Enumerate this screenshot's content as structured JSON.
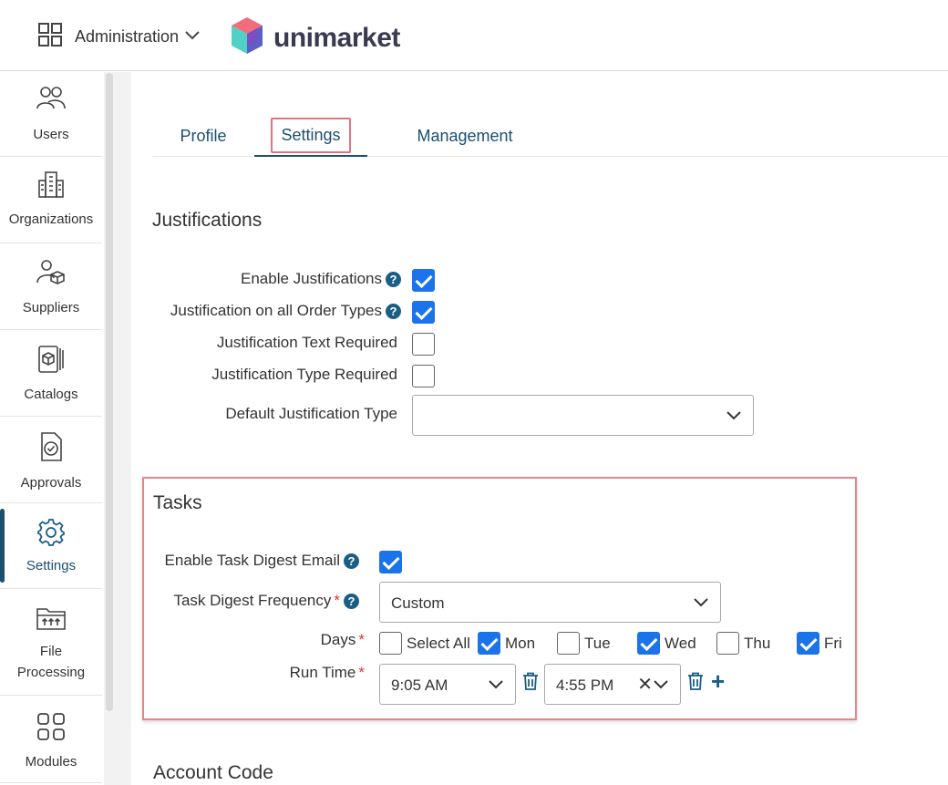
{
  "header": {
    "app_switcher_label": "Administration",
    "brand": "unimarket"
  },
  "sidebar": {
    "items": [
      {
        "label": "Users",
        "icon": "users-icon"
      },
      {
        "label": "Organizations",
        "icon": "building-icon"
      },
      {
        "label": "Suppliers",
        "icon": "supplier-icon"
      },
      {
        "label": "Catalogs",
        "icon": "catalog-icon"
      },
      {
        "label": "Approvals",
        "icon": "approval-icon"
      },
      {
        "label": "Settings",
        "icon": "gear-icon",
        "active": true
      },
      {
        "label": "File Processing",
        "line1": "File",
        "line2": "Processing",
        "icon": "file-processing-icon"
      },
      {
        "label": "Modules",
        "icon": "modules-icon"
      }
    ]
  },
  "tabs": {
    "profile": "Profile",
    "settings": "Settings",
    "management": "Management",
    "active": "Settings"
  },
  "justifications": {
    "title": "Justifications",
    "enable": {
      "label": "Enable Justifications",
      "checked": true
    },
    "all_order_types": {
      "label": "Justification on all Order Types",
      "checked": true
    },
    "text_required": {
      "label": "Justification Text Required",
      "checked": false
    },
    "type_required": {
      "label": "Justification Type Required",
      "checked": false
    },
    "default_type": {
      "label": "Default Justification Type",
      "value": ""
    }
  },
  "tasks": {
    "title": "Tasks",
    "enable_digest": {
      "label": "Enable Task Digest Email",
      "checked": true
    },
    "frequency": {
      "label": "Task Digest Frequency",
      "value": "Custom"
    },
    "days": {
      "label": "Days",
      "select_all": {
        "label": "Select All",
        "checked": false
      },
      "mon": {
        "label": "Mon",
        "checked": true
      },
      "tue": {
        "label": "Tue",
        "checked": false
      },
      "wed": {
        "label": "Wed",
        "checked": true
      },
      "thu": {
        "label": "Thu",
        "checked": false
      },
      "fri": {
        "label": "Fri",
        "checked": true
      }
    },
    "run_time": {
      "label": "Run Time",
      "times": [
        "9:05 AM",
        "4:55 PM"
      ],
      "clear_symbol": "✕",
      "add_symbol": "+"
    }
  },
  "account_code": {
    "title": "Account Code"
  },
  "help_glyph": "?",
  "required_marker": "*",
  "colors": {
    "accent": "#1b4f72",
    "checkbox": "#1a73e8",
    "highlight": "#e0747f",
    "required": "#d9383a"
  }
}
